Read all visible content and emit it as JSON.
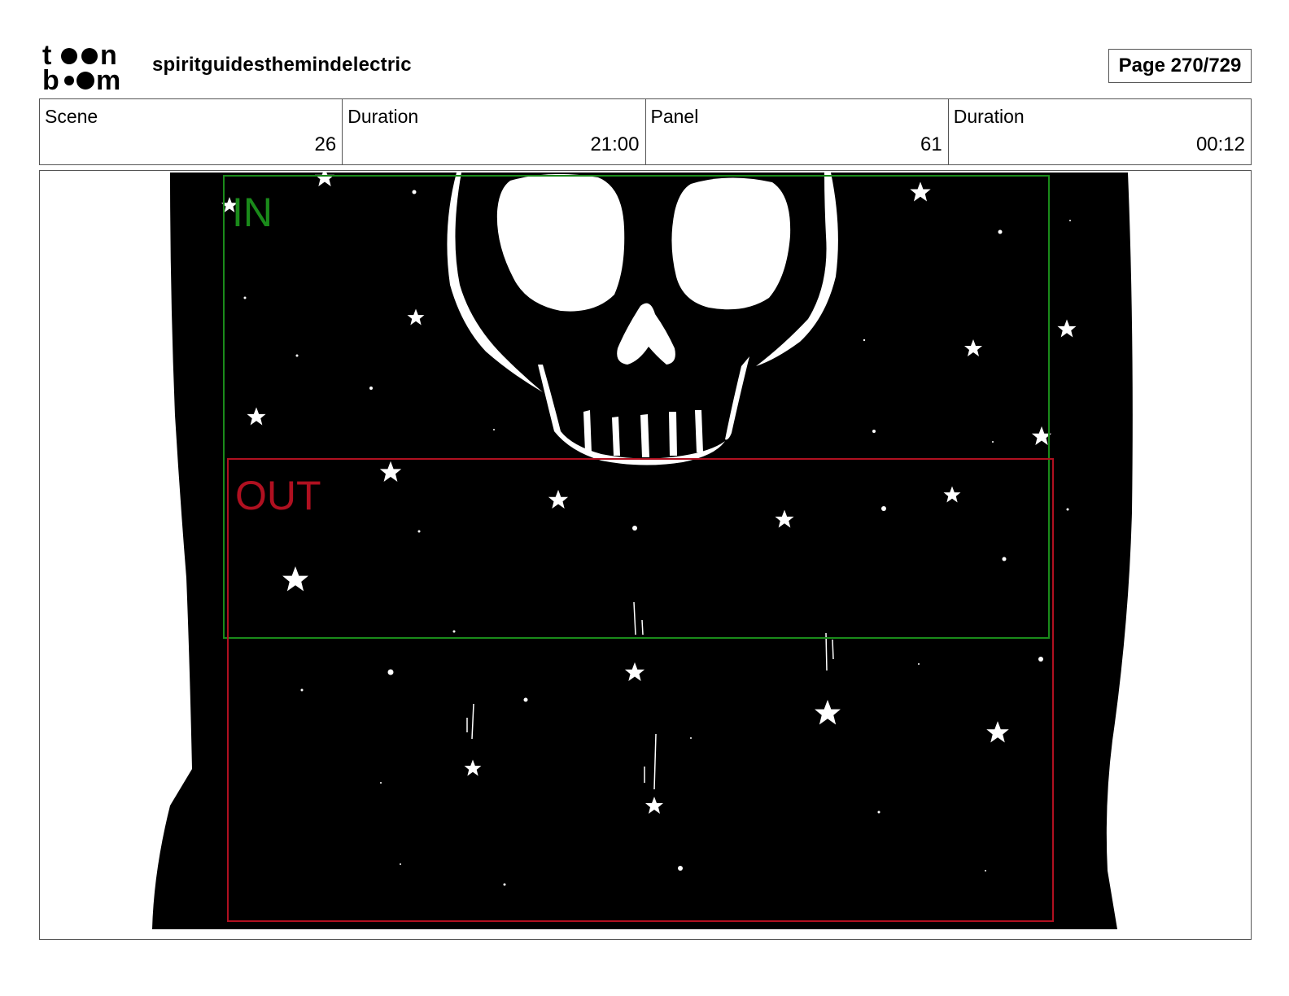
{
  "header": {
    "logo_text": "toon boom",
    "project_title": "spiritguidesthemindelectric",
    "page_label": "Page 270/729"
  },
  "info_bar": {
    "scene_label": "Scene",
    "scene_value": "26",
    "scene_duration_label": "Duration",
    "scene_duration_value": "21:00",
    "panel_label": "Panel",
    "panel_value": "61",
    "panel_duration_label": "Duration",
    "panel_duration_value": "00:12"
  },
  "panel": {
    "in_label": "IN",
    "out_label": "OUT",
    "in_color": "#1a8a1a",
    "out_color": "#b01020",
    "background_color": "#000000",
    "drawing_color": "#ffffff"
  }
}
